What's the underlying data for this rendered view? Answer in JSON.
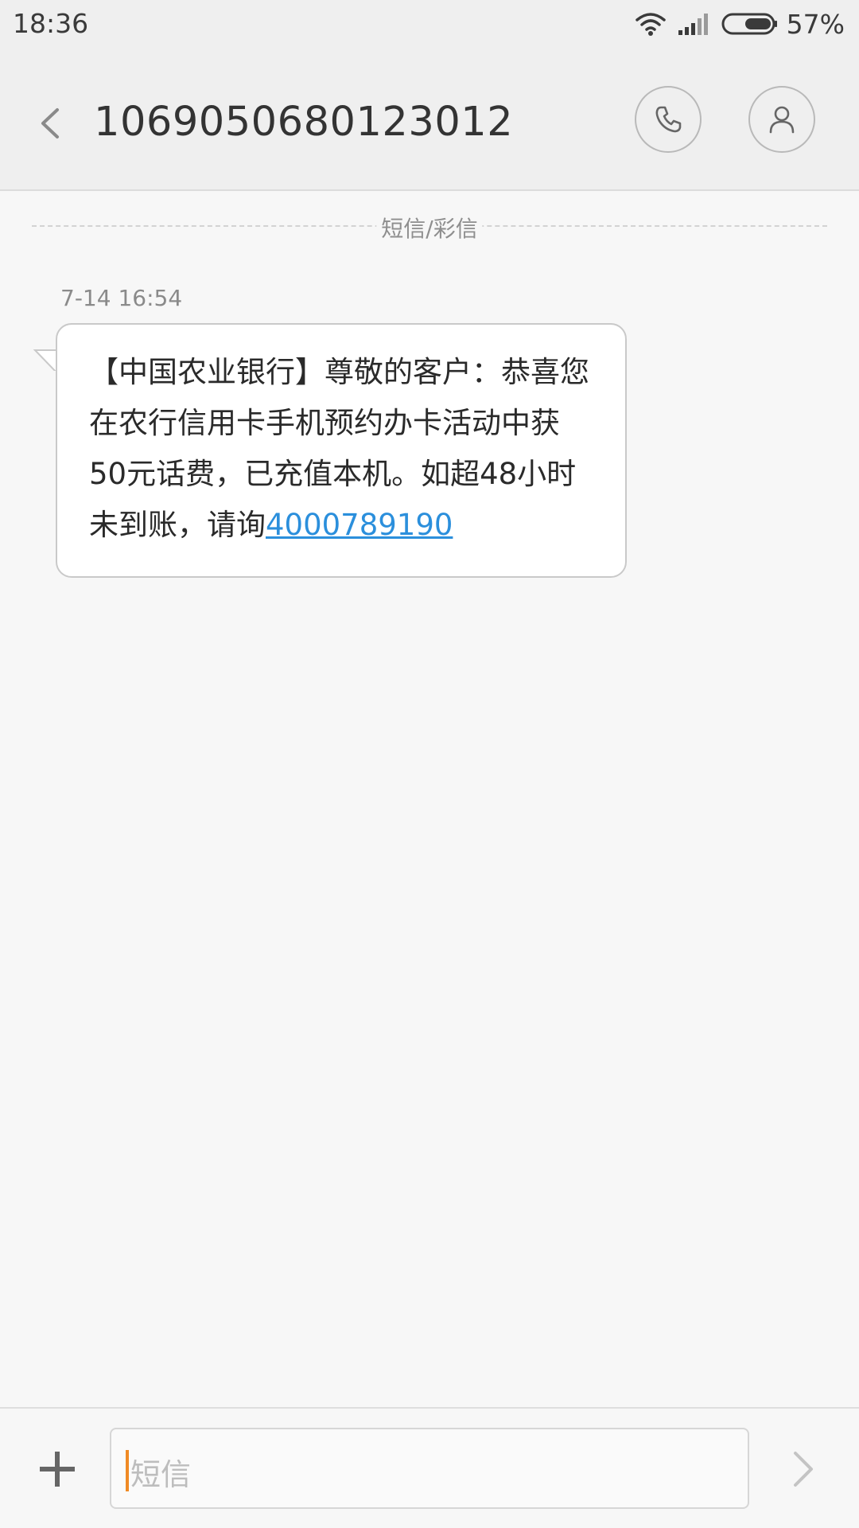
{
  "status_bar": {
    "time": "18:36",
    "battery_percent": "57%",
    "battery_level": 0.57,
    "icons": [
      "wifi-icon",
      "signal-icon",
      "battery-icon"
    ]
  },
  "header": {
    "contact_number": "1069050680123012",
    "icons": [
      "back-arrow-icon",
      "phone-icon",
      "person-icon"
    ]
  },
  "conversation": {
    "type_divider": "短信/彩信",
    "messages": [
      {
        "timestamp": "7-14 16:54",
        "text_lines": [
          "【中国农业银行】尊敬的客户：恭喜您",
          "在农行信用卡手机预约办卡活动中获",
          "50元话费，已充值本机。如超48小时"
        ],
        "last_line_prefix": "未到账，请询",
        "phone_link": "4000789190"
      }
    ]
  },
  "composer": {
    "placeholder": "短信",
    "icons": [
      "plus-icon",
      "send-arrow-icon"
    ]
  },
  "colors": {
    "link": "#2b8fdc",
    "caret": "#f08a24",
    "header_bg": "#efefef",
    "page_bg": "#f7f7f7"
  }
}
